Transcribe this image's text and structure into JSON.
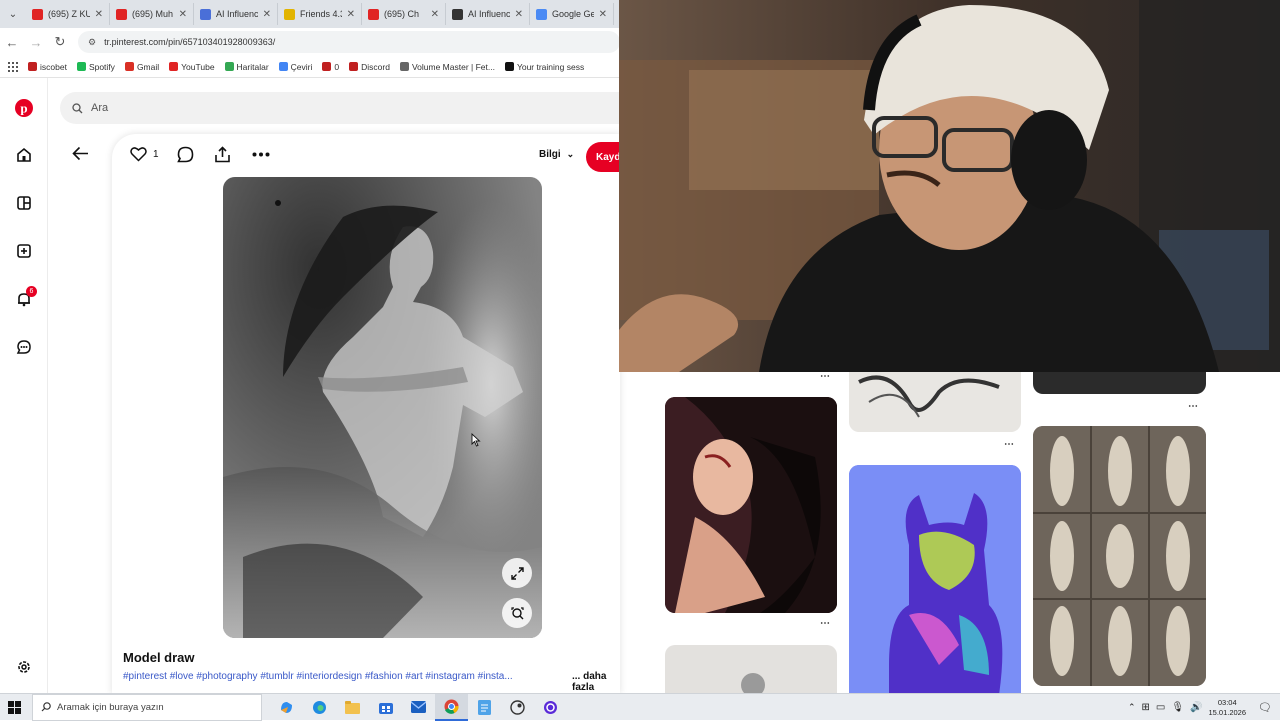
{
  "browser": {
    "tabs": [
      {
        "label": "(695) Z KU",
        "color": "#e02424"
      },
      {
        "label": "(695) Muh",
        "color": "#e02424"
      },
      {
        "label": "AI Influenc",
        "color": "#4a6fd8"
      },
      {
        "label": "Friends 4.3",
        "color": "#e2b400"
      },
      {
        "label": "(695) Ch",
        "color": "#e02424"
      },
      {
        "label": "AI Influenc",
        "color": "#333333"
      },
      {
        "label": "Google Ge",
        "color": "#4a8af4"
      }
    ],
    "url": "tr.pinterest.com/pin/657103401928009363/",
    "bookmarks": [
      {
        "label": "iscobet",
        "color": "#c02020"
      },
      {
        "label": "Spotify",
        "color": "#1db954"
      },
      {
        "label": "Gmail",
        "color": "#d93025"
      },
      {
        "label": "YouTube",
        "color": "#e02424"
      },
      {
        "label": "Haritalar",
        "color": "#34a853"
      },
      {
        "label": "Çeviri",
        "color": "#4285f4"
      },
      {
        "label": "0",
        "color": "#c02020"
      },
      {
        "label": "Discord",
        "color": "#c02020"
      },
      {
        "label": "Volume Master | Fet...",
        "color": "#666666"
      },
      {
        "label": "Your training sess",
        "color": "#111111"
      }
    ]
  },
  "pinterest": {
    "notification_count": "6",
    "search_placeholder": "Ara",
    "like_count": "1",
    "info_label": "Bilgi",
    "save_label": "Kaydet",
    "title": "Model draw",
    "tags": "#pinterest #love #photography #tumblr #interiordesign #fashion #art #instagram #insta...",
    "more_label": "... daha fazla",
    "brand_color": "#e60023"
  },
  "taskbar": {
    "search_placeholder": "Aramak için buraya yazın",
    "time": "03:04",
    "date": "15.01.2026"
  }
}
